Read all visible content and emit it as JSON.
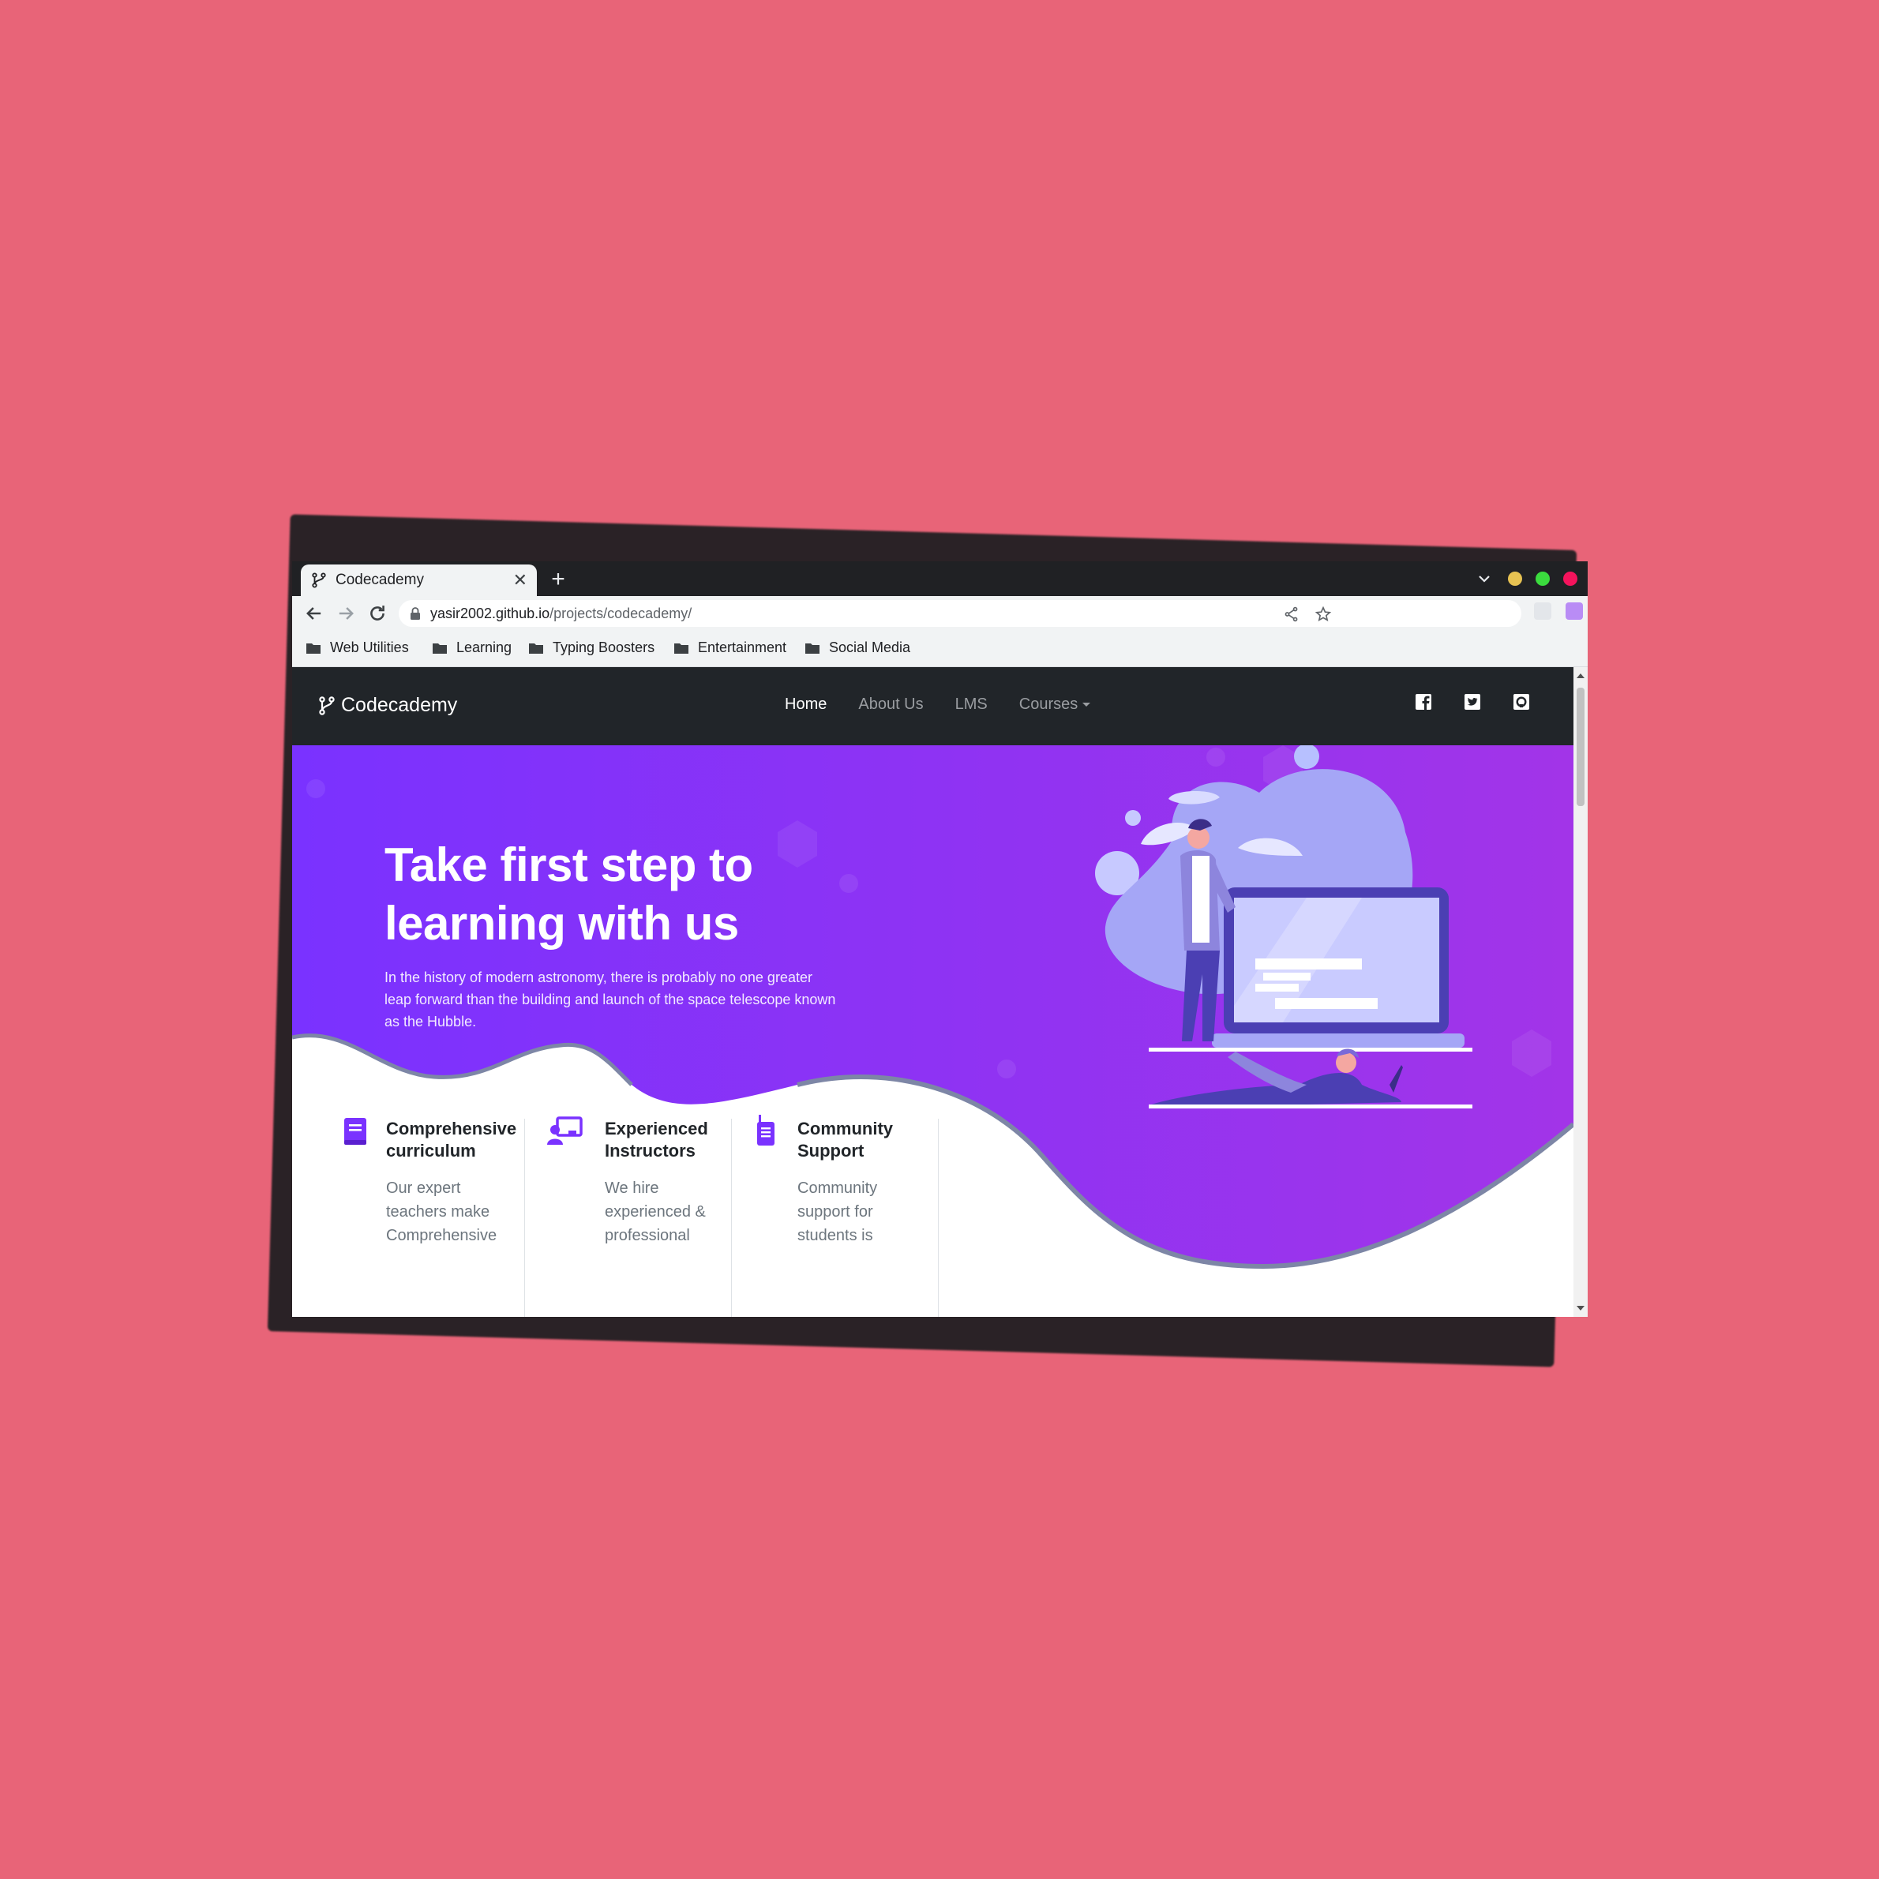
{
  "browser": {
    "tab_title": "Codecademy",
    "new_tab": "+",
    "url_host": "yasir2002.github.io",
    "url_path": "/projects/codecademy/",
    "bookmarks": [
      "Web Utilities",
      "Learning",
      "Typing Boosters",
      "Entertainment",
      "Social Media"
    ],
    "window_controls": {
      "minimize_color": "#e7c252",
      "maximize_color": "#3bdc3e",
      "close_color": "#f5135c"
    }
  },
  "site": {
    "brand": "Codecademy",
    "nav": [
      "Home",
      "About Us",
      "LMS",
      "Courses"
    ],
    "active_nav": "Home",
    "social_icons": [
      "facebook-icon",
      "twitter-icon",
      "github-icon"
    ]
  },
  "hero": {
    "title_line1": "Take first step to",
    "title_line2": "learning with us",
    "text": "In the history of modern astronomy, there is probably no one greater leap forward than the building and launch of the space telescope known as the Hubble.",
    "colors": {
      "gradient_start": "#7a32ff",
      "gradient_end": "#a234e8"
    }
  },
  "features": [
    {
      "title_1": "Comprehensive",
      "title_2": "curriculum",
      "text_1": "Our expert",
      "text_2": "teachers make",
      "text_3": "Comprehensive",
      "icon": "book-icon"
    },
    {
      "title_1": "Experienced",
      "title_2": "Instructors",
      "text_1": "We hire",
      "text_2": "experienced &",
      "text_3": "professional",
      "icon": "instructor-icon"
    },
    {
      "title_1": "Community",
      "title_2": "Support",
      "text_1": "Community",
      "text_2": "support for",
      "text_3": "students is",
      "icon": "walkie-talkie-icon"
    }
  ]
}
